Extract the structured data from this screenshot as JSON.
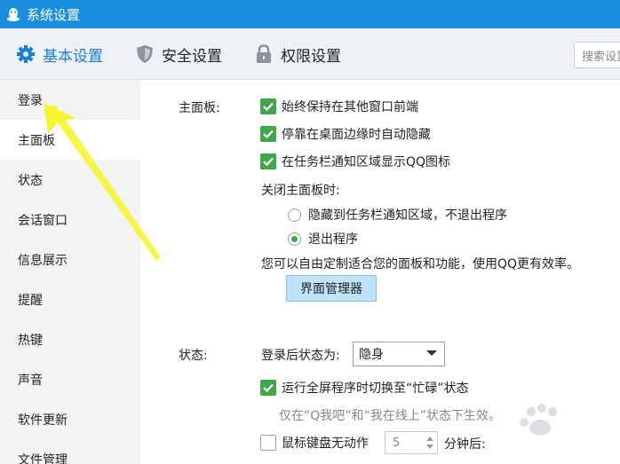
{
  "window": {
    "title": "系统设置"
  },
  "tabs": [
    {
      "label": "基本设置",
      "icon": "gear-icon",
      "active": true
    },
    {
      "label": "安全设置",
      "icon": "shield-icon",
      "active": false
    },
    {
      "label": "权限设置",
      "icon": "lock-icon",
      "active": false
    }
  ],
  "search": {
    "placeholder": "搜索设置"
  },
  "sidebar": {
    "items": [
      {
        "label": "登录"
      },
      {
        "label": "主面板"
      },
      {
        "label": "状态"
      },
      {
        "label": "会话窗口"
      },
      {
        "label": "信息展示"
      },
      {
        "label": "提醒"
      },
      {
        "label": "热键"
      },
      {
        "label": "声音"
      },
      {
        "label": "软件更新"
      },
      {
        "label": "文件管理"
      }
    ],
    "active_index": 1
  },
  "main_panel": {
    "label": "主面板:",
    "options": [
      {
        "label": "始终保持在其他窗口前端",
        "checked": true
      },
      {
        "label": "停靠在桌面边缘时自动隐藏",
        "checked": true
      },
      {
        "label": "在任务栏通知区域显示QQ图标",
        "checked": true
      }
    ],
    "close_label": "关闭主面板时:",
    "close_options": [
      {
        "label": "隐藏到任务栏通知区域，不退出程序",
        "selected": false
      },
      {
        "label": "退出程序",
        "selected": true
      }
    ],
    "description": "您可以自由定制适合您的面板和功能，使用QQ更有效率。",
    "ui_manager_button": "界面管理器"
  },
  "status_section": {
    "label": "状态:",
    "after_login_label": "登录后状态为:",
    "after_login_value": "隐身",
    "fullscreen_busy": {
      "label": "运行全屏程序时切换至“忙碌”状态",
      "checked": true
    },
    "fullscreen_hint": "仅在“Q我吧”和“我在线上”状态下生效。",
    "idle": {
      "label": "鼠标键盘无动作",
      "checked": false
    },
    "idle_minutes": "5",
    "idle_suffix": "分钟后:"
  },
  "colors": {
    "titlebar": "#1a8ee0",
    "accent": "#1a7ed6",
    "check_green": "#3fa64a",
    "annotation_arrow": "#f5f530"
  }
}
